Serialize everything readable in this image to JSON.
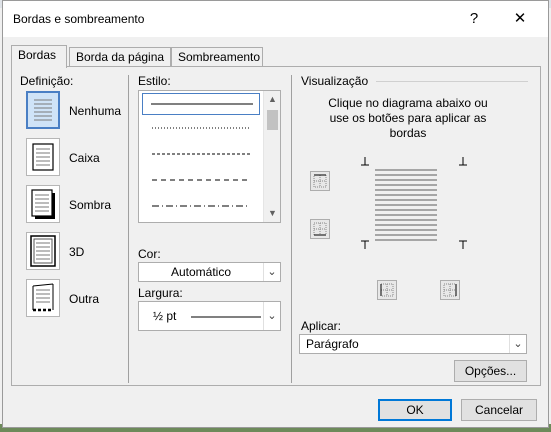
{
  "window": {
    "title": "Bordas e sombreamento",
    "help_label": "?",
    "close_label": "✕"
  },
  "tabs": [
    {
      "label": "Bordas"
    },
    {
      "label": "Borda da página"
    },
    {
      "label": "Sombreamento"
    }
  ],
  "setting": {
    "heading": "Definição:",
    "options": [
      {
        "label": "Nenhuma",
        "selected": true
      },
      {
        "label": "Caixa"
      },
      {
        "label": "Sombra"
      },
      {
        "label": "3D"
      },
      {
        "label": "Outra"
      }
    ]
  },
  "style": {
    "heading": "Estilo:",
    "items": [
      "solid",
      "dotted",
      "dashed-small",
      "dashed",
      "dash-dot"
    ],
    "selected_index": 0
  },
  "color": {
    "label": "Cor:",
    "value": "Automático"
  },
  "width": {
    "label": "Largura:",
    "value": "½ pt"
  },
  "preview": {
    "heading": "Visualização",
    "hint": "Clique no diagrama abaixo ou use os botões para aplicar as bordas"
  },
  "apply": {
    "label": "Aplicar:",
    "value": "Parágrafo"
  },
  "buttons": {
    "options": "Opções...",
    "ok": "OK",
    "cancel": "Cancelar"
  },
  "colors": {
    "accent": "#0078d7",
    "selected_bg": "#cfe3f7"
  }
}
